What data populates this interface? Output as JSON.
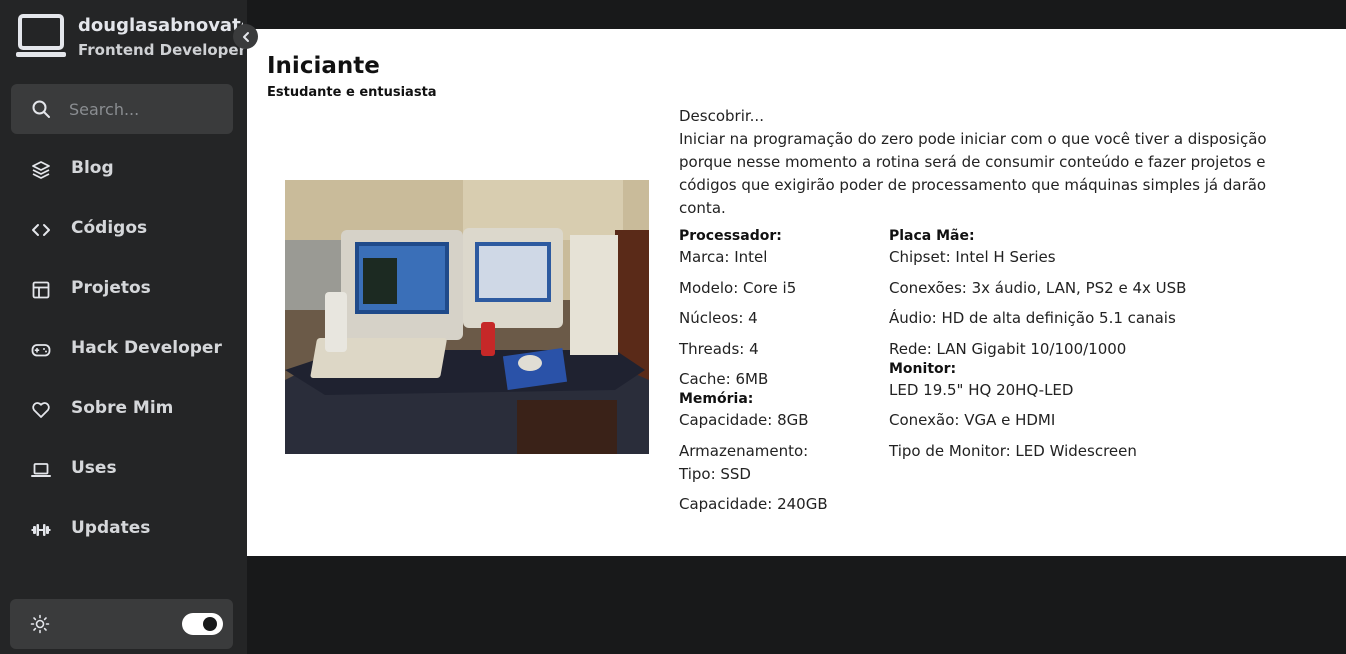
{
  "profile": {
    "name": "douglasabnovato",
    "role": "Frontend Developer"
  },
  "search": {
    "placeholder": "Search..."
  },
  "nav": {
    "items": [
      {
        "label": "Blog",
        "icon": "layers-icon"
      },
      {
        "label": "Códigos",
        "icon": "code-icon"
      },
      {
        "label": "Projetos",
        "icon": "layout-icon"
      },
      {
        "label": "Hack Developer",
        "icon": "gamepad-icon"
      },
      {
        "label": "Sobre Mim",
        "icon": "heart-icon"
      },
      {
        "label": "Uses",
        "icon": "laptop-icon"
      },
      {
        "label": "Updates",
        "icon": "dumbbell-icon"
      }
    ]
  },
  "theme": {
    "icon": "sun-icon",
    "dark_mode": true
  },
  "content": {
    "title": "Iniciante",
    "subtitle": "Estudante e entusiasta",
    "intro_heading": "Descobrir...",
    "intro_text": "Iniciar na programação do zero pode iniciar com o que você tiver a disposição porque nesse momento a rotina será de consumir conteúdo e fazer projetos e códigos que exigirão poder de processamento que máquinas simples já darão conta.",
    "processador": {
      "heading": "Processador:",
      "marca": "Marca: Intel",
      "modelo": "Modelo: Core i5",
      "nucleos": "Núcleos: 4",
      "threads": "Threads: 4",
      "cache": "Cache: 6MB"
    },
    "memoria": {
      "heading": "Memória:",
      "capacidade": "Capacidade: 8GB"
    },
    "armazenamento": {
      "heading": "Armazenamento:",
      "tipo": "Tipo: SSD",
      "capacidade": "Capacidade: 240GB"
    },
    "placa_mae": {
      "heading": "Placa Mãe:",
      "chipset": "Chipset: Intel H Series",
      "conexoes": "Conexões: 3x áudio, LAN, PS2 e 4x USB",
      "audio": "Áudio: HD de alta definição 5.1 canais",
      "rede": "Rede: LAN Gigabit 10/100/1000"
    },
    "monitor": {
      "heading": "Monitor:",
      "modelo": "LED 19.5\" HQ 20HQ-LED",
      "conexao": "Conexão: VGA e HDMI",
      "tipo": "Tipo de Monitor: LED Widescreen"
    }
  }
}
